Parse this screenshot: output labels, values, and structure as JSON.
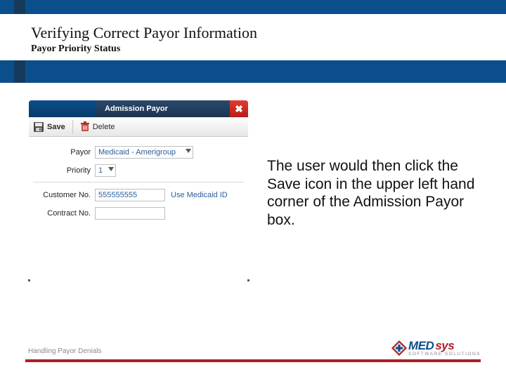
{
  "header": {
    "title": "Verifying Correct Payor Information",
    "subtitle": "Payor Priority Status"
  },
  "admission_payor": {
    "window_title": "Admission Payor",
    "close_glyph": "✖",
    "toolbar": {
      "save_label": "Save",
      "delete_label": "Delete"
    },
    "fields": {
      "payor_label": "Payor",
      "payor_value": "Medicaid - Amerigroup",
      "priority_label": "Priority",
      "priority_value": "1",
      "customer_no_label": "Customer No.",
      "customer_no_value": "555555555",
      "use_medicaid_link": "Use Medicaid ID",
      "contract_no_label": "Contract No.",
      "contract_no_value": ""
    }
  },
  "instruction_text": "The user would then click the Save icon in the upper left hand corner of the Admission Payor box.",
  "footer": {
    "text": "Handling Payor Denials",
    "logo_med": "MED",
    "logo_sys": "sys",
    "logo_tag": "SOFTWARE SOLUTIONS"
  }
}
